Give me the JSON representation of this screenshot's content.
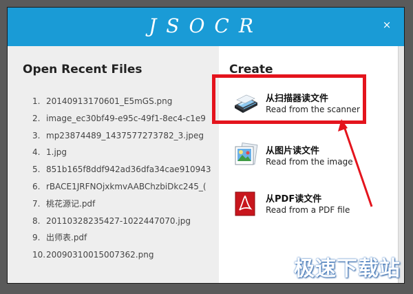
{
  "app": {
    "title": "JSOCR",
    "close_glyph": "×"
  },
  "recent": {
    "title": "Open Recent Files",
    "items": [
      {
        "num": "1.",
        "name": "20140913170601_E5mGS.png"
      },
      {
        "num": "2.",
        "name": "image_ec30bf49-e95c-49f1-8ec4-c1e9"
      },
      {
        "num": "3.",
        "name": "mp23874489_1437577273782_3.jpeg"
      },
      {
        "num": "4.",
        "name": "1.jpg"
      },
      {
        "num": "5.",
        "name": "851b165f8ddf942ad36dfa34cae910943"
      },
      {
        "num": "6.",
        "name": "rBACE1JRFNOjxkmvAABChzbiDkc245_("
      },
      {
        "num": "7.",
        "name": "桃花源记.pdf"
      },
      {
        "num": "8.",
        "name": "20110328235427-1022447070.jpg"
      },
      {
        "num": "9.",
        "name": "出师表.pdf"
      },
      {
        "num": "10.",
        "name": "20090310015007362.png"
      }
    ]
  },
  "create": {
    "title": "Create",
    "items": [
      {
        "icon": "scanner-icon",
        "label_cn": "从扫描器读文件",
        "label_en": "Read from the scanner"
      },
      {
        "icon": "image-file-icon",
        "label_cn": "从图片读文件",
        "label_en": "Read from the image"
      },
      {
        "icon": "pdf-file-icon",
        "label_cn": "从PDF读文件",
        "label_en": "Read from a PDF file"
      }
    ]
  },
  "watermark": {
    "text": "极速下载站"
  },
  "colors": {
    "titlebar": "#1a9bd6",
    "highlight": "#e4141d",
    "left_pane": "#eeeeee"
  }
}
